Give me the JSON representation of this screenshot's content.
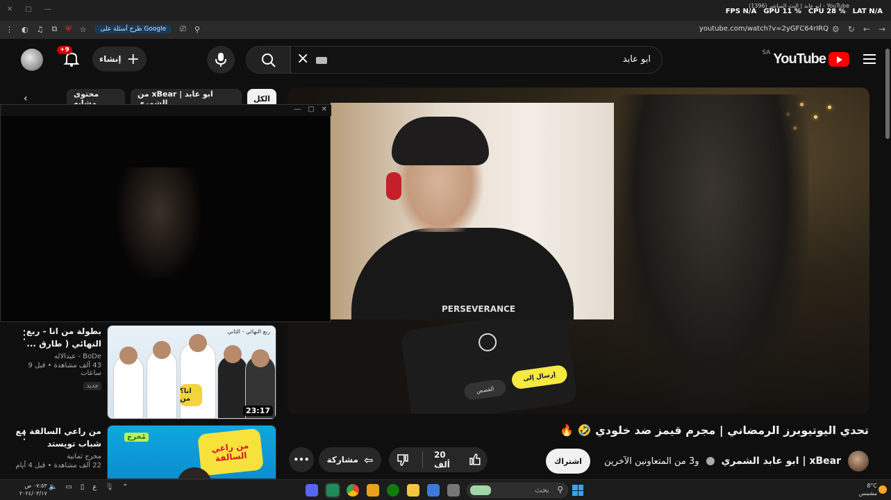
{
  "overlay": {
    "tab_title": "ابو عابد | البث المباشر (1396) - YouTube",
    "stats": [
      {
        "label": "FPS",
        "value": "N/A"
      },
      {
        "label": "GPU",
        "value": "11 %"
      },
      {
        "label": "CPU",
        "value": "28 %"
      },
      {
        "label": "LAT",
        "value": "N/A"
      }
    ]
  },
  "browser": {
    "url": "youtube.com/watch?v=2yGFC64rIRQ",
    "google_pill": "طرح أسئلة على Google"
  },
  "header": {
    "brand": "YouTube",
    "country": "SA",
    "search_value": "ابو عابد",
    "create_label": "إنشاء",
    "notif_badge": "+9"
  },
  "chips": {
    "all": "الكل",
    "from": "من xBear | ابو عابد الشمري",
    "related": "محتوى مشابه"
  },
  "player": {
    "phone_send": "إرسال إلى",
    "phone_story": "القصص",
    "cam_shirt": "PERSEVERANCE"
  },
  "video": {
    "title": "تحدي اليوتيوبرز الرمضاني | مجرم قيمز ضد خلودي 🤣 🔥",
    "channel": "xBear | ابو عابد الشمري",
    "collab": "و3 من المتعاونين الآخرين",
    "subscribe": "اشتراك",
    "likes": "20 ألف",
    "share": "مشاركة"
  },
  "recommendations": [
    {
      "title": "بطولة من انا - ربع النهائي ( طارق ...",
      "channel": "BoDe - عبدالاله",
      "stats": "43 ألف مشاهدة • قبل 9 ساعات",
      "badge": "جديد",
      "duration": "23:17",
      "thumb_label": "ربع النهائي - الثاني",
      "thumb_badge": "انا؟ من"
    },
    {
      "title": "من راعي السالفة مع شباب تويستد",
      "channel": "مخرج ثمانية",
      "stats": "22 ألف مشاهدة • قبل 4 أيام",
      "thumb_label": "مُخرج",
      "thumb_logo": "من راعي السالفة"
    }
  ],
  "taskbar": {
    "search": "بحث",
    "lang": "ع",
    "time": "٠٧:٥٣ ص",
    "date": "٢٠٢٤/٠٣/١٧",
    "temp": "8°C",
    "weather": "مشمس"
  },
  "colors": {
    "accent_red": "#ff0000",
    "background": "#0f0f0f",
    "chip_active": "#f1f1f1"
  }
}
